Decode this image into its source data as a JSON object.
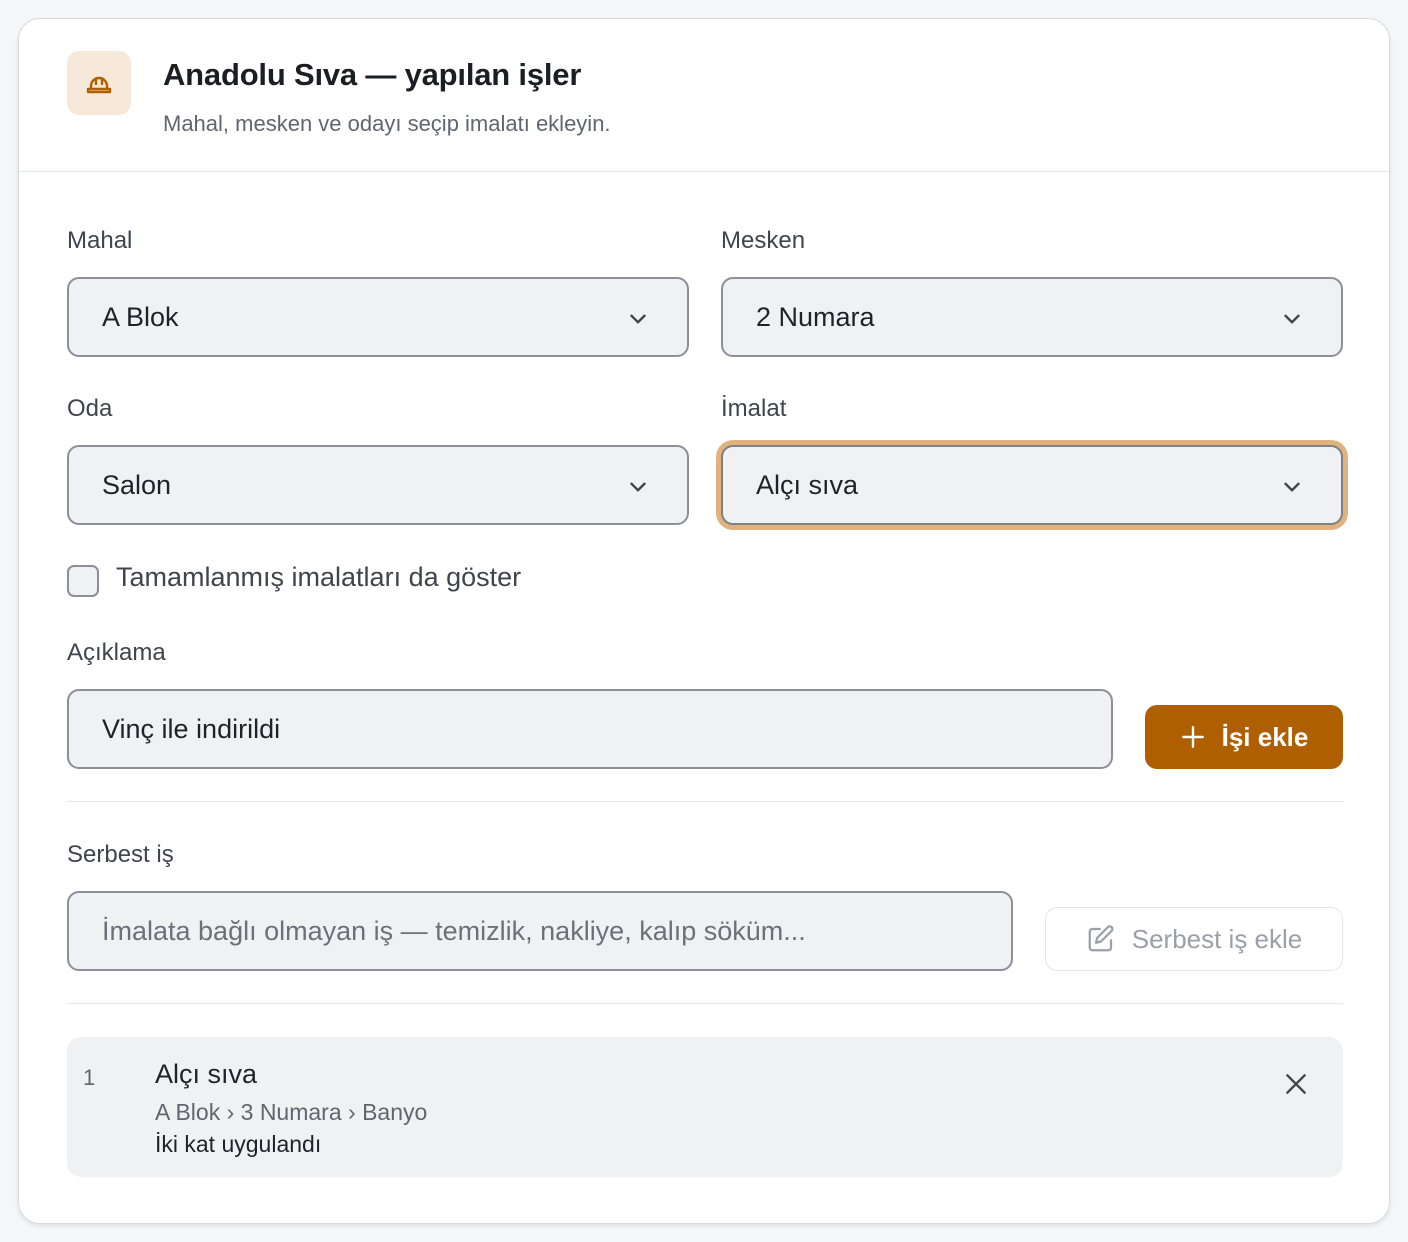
{
  "header": {
    "icon": "hard-hat-icon",
    "title": "Anadolu Sıva — yapılan işler",
    "subtitle": "Mahal, mesken ve odayı seçip imalatı ekleyin."
  },
  "form": {
    "mahal": {
      "label": "Mahal",
      "value": "A Blok"
    },
    "mesken": {
      "label": "Mesken",
      "value": "2 Numara"
    },
    "oda": {
      "label": "Oda",
      "value": "Salon"
    },
    "imalat": {
      "label": "İmalat",
      "value": "Alçı sıva"
    },
    "show_completed": {
      "label": "Tamamlanmış imalatları da göster",
      "checked": false
    },
    "aciklama": {
      "label": "Açıklama",
      "value": "Vinç ile indirildi"
    },
    "add_button": "İşi ekle"
  },
  "free_job": {
    "label": "Serbest iş",
    "placeholder": "İmalata bağlı olmayan iş — temizlik, nakliye, kalıp söküm...",
    "button": "Serbest iş ekle"
  },
  "jobs": [
    {
      "index": "1",
      "title": "Alçı sıva",
      "path": "A Blok › 3 Numara › Banyo",
      "note": "İki kat uygulandı"
    }
  ],
  "colors": {
    "accent": "#b05f00",
    "focus_ring": "#e2b27c",
    "icon_bg": "#f7e9da"
  }
}
